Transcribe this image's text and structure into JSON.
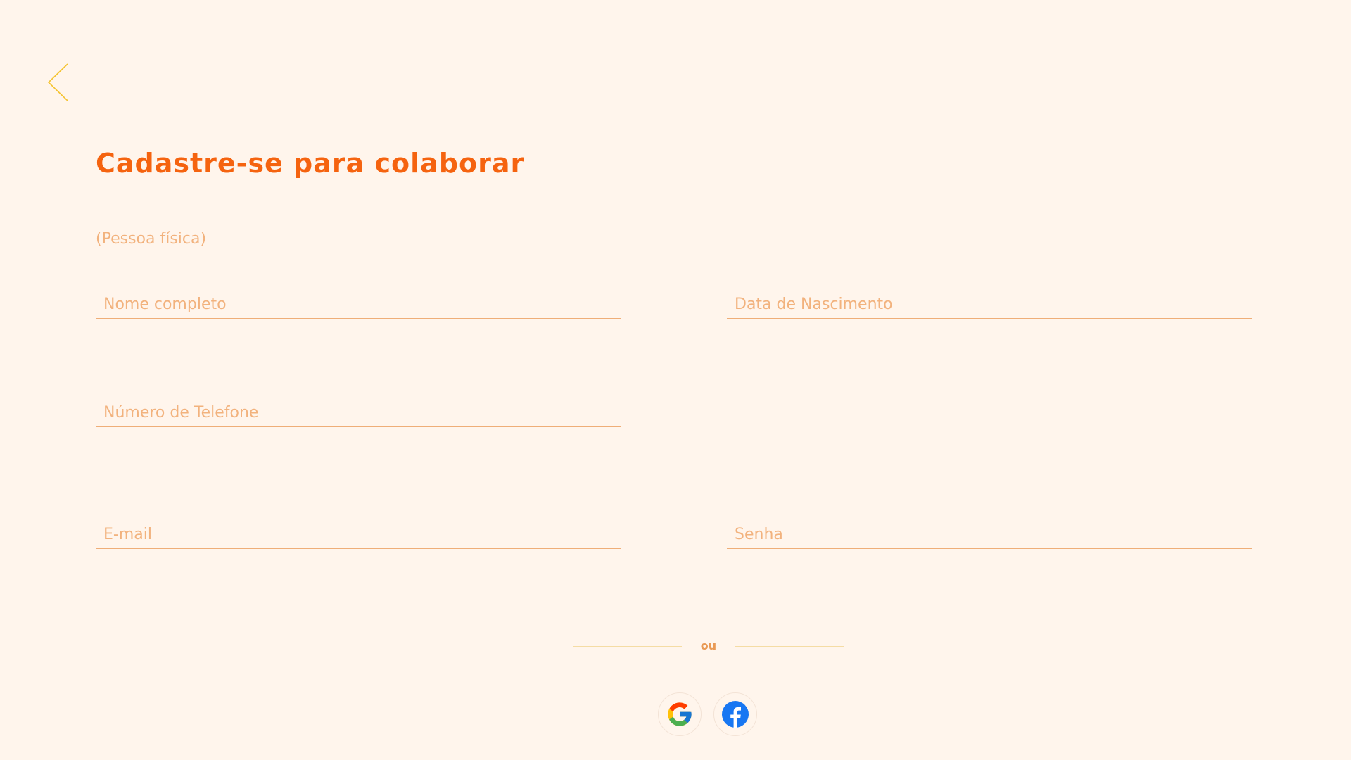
{
  "header": {
    "back_icon": "chevron-left-icon",
    "title": "Cadastre-se para colaborar",
    "subtitle": "(Pessoa física)"
  },
  "form": {
    "full_name": {
      "placeholder": "Nome completo",
      "value": ""
    },
    "birth_date": {
      "placeholder": "Data de Nascimento",
      "value": ""
    },
    "phone": {
      "placeholder": "Número de Telefone",
      "value": ""
    },
    "email": {
      "placeholder": "E-mail",
      "value": ""
    },
    "password": {
      "placeholder": "Senha",
      "value": ""
    }
  },
  "divider": {
    "label": "ou"
  },
  "social": [
    {
      "name": "Google",
      "icon": "google-icon"
    },
    {
      "name": "Facebook",
      "icon": "facebook-icon"
    }
  ],
  "colors": {
    "background": "#fff5ec",
    "title": "#f5630f",
    "placeholder": "#f2b27d",
    "field_underline": "#efae78",
    "back_chevron": "#f5c330",
    "divider_line": "#f5dca4",
    "divider_text": "#e99a55",
    "facebook_blue": "#1877f2"
  }
}
